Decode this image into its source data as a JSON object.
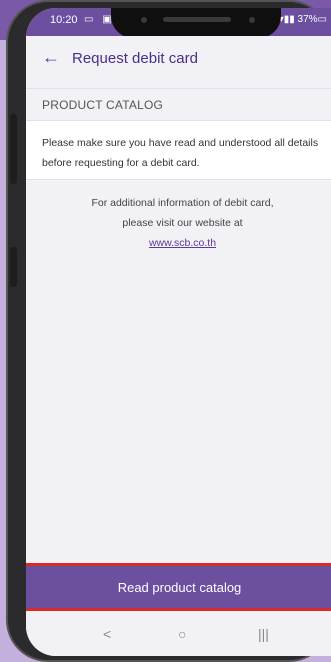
{
  "status_bar": {
    "time": "10:20",
    "left_icons": "▭ ▣",
    "right_icons": "▾▮▮ 37%▭"
  },
  "app_bar": {
    "back_icon": "arrow-left",
    "title": "Request debit card"
  },
  "section": {
    "title": "PRODUCT CATALOG"
  },
  "notice": {
    "text": "Please make sure you have read and understood all details before requesting for a debit card."
  },
  "info": {
    "line1": "For additional information of debit card,",
    "line2": "please visit our website at",
    "link": "www.scb.co.th"
  },
  "cta": {
    "label": "Read product catalog"
  },
  "nav_bar": {
    "back": "<",
    "home": "○",
    "recents": "|||"
  },
  "colors": {
    "brand_purple": "#6d4fa0",
    "highlight_red": "#d62b2b"
  }
}
